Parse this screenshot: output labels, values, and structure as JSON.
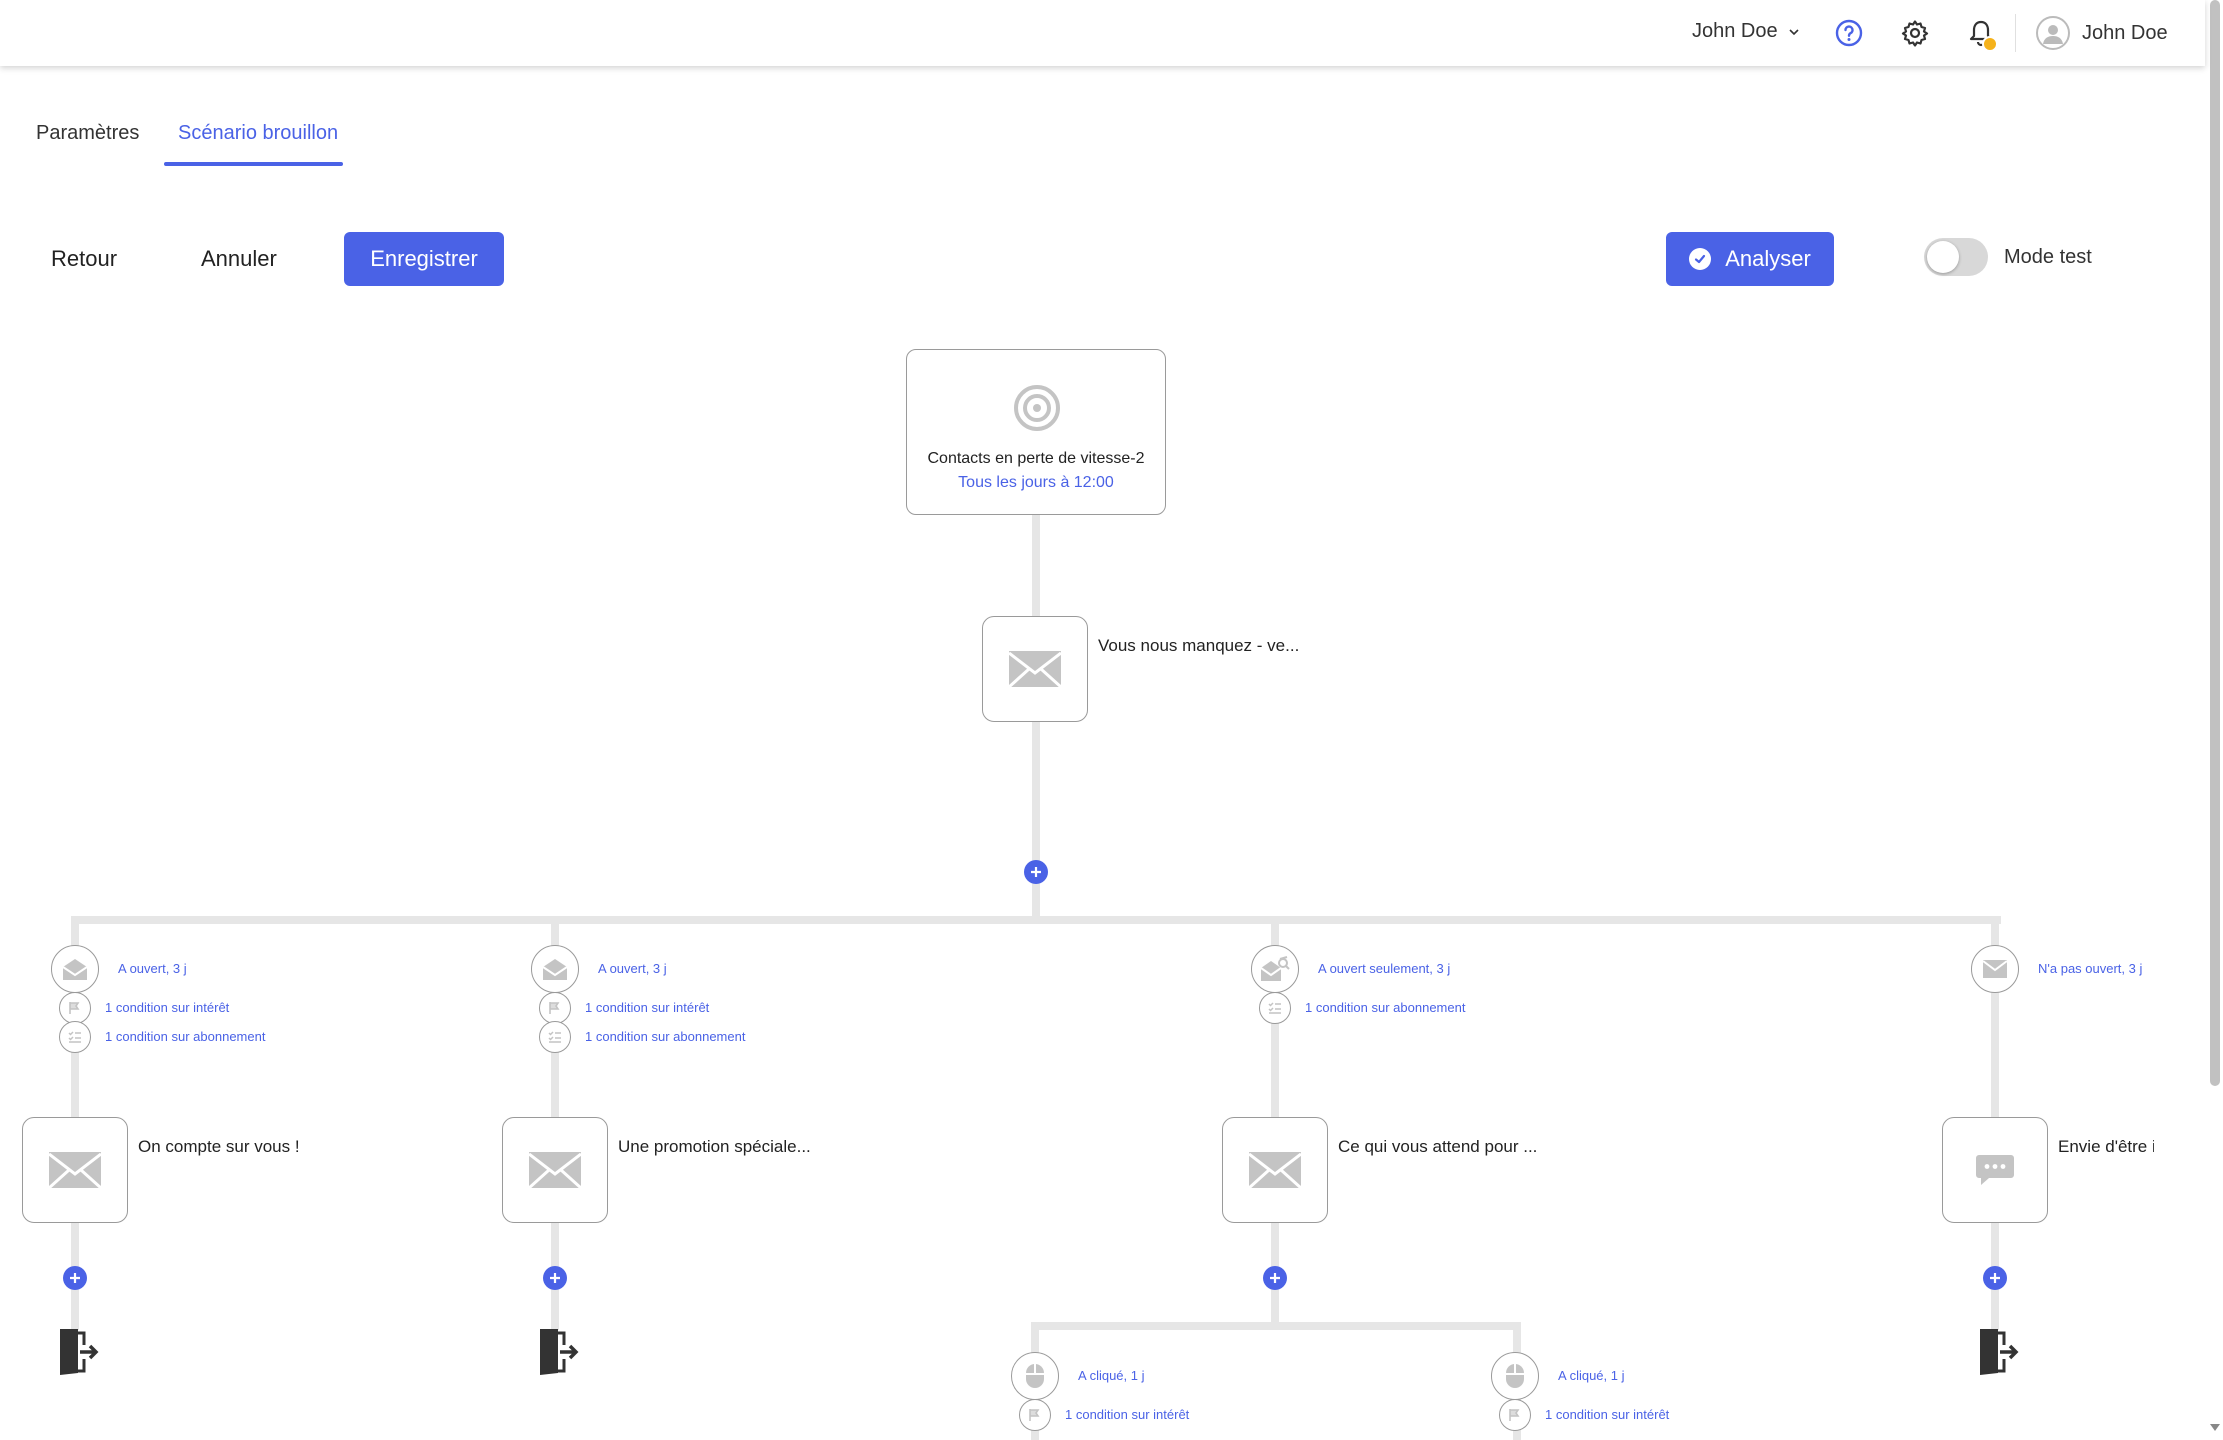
{
  "topbar": {
    "account_name": "John Doe",
    "profile_name": "John Doe",
    "help_icon": "help-circle-icon",
    "settings_icon": "gear-icon",
    "notifications_icon": "bell-icon"
  },
  "tabs": [
    {
      "label": "Paramètres",
      "active": false
    },
    {
      "label": "Scénario brouillon",
      "active": true
    }
  ],
  "toolbar": {
    "back_label": "Retour",
    "cancel_label": "Annuler",
    "save_label": "Enregistrer",
    "analyse_label": "Analyser",
    "test_mode_label": "Mode test",
    "test_mode_on": false
  },
  "scenario": {
    "start": {
      "title": "Contacts en perte de vitesse-2",
      "schedule": "Tous les jours à 12:00",
      "icon": "target-icon"
    },
    "first_email": {
      "label": "Vous nous manquez - ve..."
    },
    "branches": [
      {
        "trigger": "A ouvert,  3 j",
        "conditions": [
          "1 condition sur intérêt",
          "1 condition sur abonnement"
        ],
        "email_label": "On compte sur vous !",
        "node_icon": "envelope-icon"
      },
      {
        "trigger": "A ouvert,  3 j",
        "conditions": [
          "1 condition sur intérêt",
          "1 condition sur abonnement"
        ],
        "email_label": "Une promotion spéciale...",
        "node_icon": "envelope-icon"
      },
      {
        "trigger": "A ouvert seulement,  3 j",
        "conditions": [
          "1 condition sur abonnement"
        ],
        "email_label": "Ce qui vous attend pour ...",
        "node_icon": "envelope-icon"
      },
      {
        "trigger": "N'a pas ouvert,  3 j",
        "conditions": [],
        "email_label": "Envie d'être ir",
        "node_icon": "sms-icon"
      }
    ],
    "sub_branches": [
      {
        "trigger": "A cliqué,  1 j",
        "condition": "1 condition sur intérêt"
      },
      {
        "trigger": "A cliqué,  1 j",
        "condition": "1 condition sur intérêt"
      }
    ]
  }
}
